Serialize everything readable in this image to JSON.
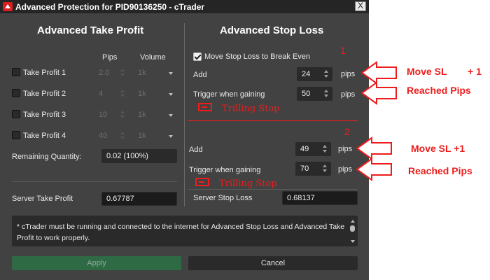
{
  "window": {
    "title": "Advanced Protection for PID90136250 - cTrader",
    "close_label": "X"
  },
  "take_profit": {
    "title": "Advanced Take Profit",
    "col_pips": "Pips",
    "col_volume": "Volume",
    "rows": [
      {
        "label": "Take Profit 1",
        "pips": "2.0",
        "volume": "1k",
        "checked": false
      },
      {
        "label": "Take Profit 2",
        "pips": "4",
        "volume": "1k",
        "checked": false
      },
      {
        "label": "Take Profit 3",
        "pips": "10",
        "volume": "1k",
        "checked": false
      },
      {
        "label": "Take Profit 4",
        "pips": "40",
        "volume": "1k",
        "checked": false
      }
    ],
    "remaining_label": "Remaining Quantity:",
    "remaining_value": "0.02 (100%)",
    "server_label": "Server Take Profit",
    "server_value": "0.67787"
  },
  "stop_loss": {
    "title": "Advanced Stop Loss",
    "break_even_label": "Move Stop Loss to Break Even",
    "break_even_checked": true,
    "add_label": "Add",
    "add_value": "24",
    "add_unit": "pips",
    "trigger_label": "Trigger when gaining",
    "trigger_value": "50",
    "trigger_unit": "pips",
    "add2_label": "Add",
    "add2_value": "49",
    "add2_unit": "pips",
    "trigger2_label": "Trigger when gaining",
    "trigger2_value": "70",
    "trigger2_unit": "pips",
    "server_label": "Server Stop Loss",
    "server_value": "0.68137"
  },
  "notice": "* cTrader must be running and connected to the internet for Advanced Stop Loss and Advanced Take Profit to work properly.",
  "buttons": {
    "apply": "Apply",
    "cancel": "Cancel"
  },
  "annotations": {
    "num1": "1",
    "num2": "2",
    "move_sl": "Move SL",
    "plus_one": "+ 1",
    "reached_pips_1": "Reached Pips",
    "trailing_1": "Trilling Stop",
    "move_sl_2": "Move SL +1",
    "reached_pips_2": "Reached Pips",
    "trailing_2": "Trilling Stop",
    "color": "#ee1c1c"
  }
}
